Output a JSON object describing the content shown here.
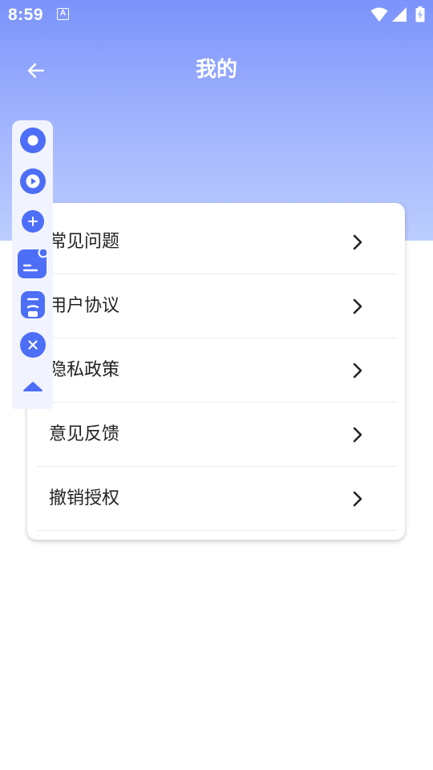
{
  "status_bar": {
    "time": "8:59",
    "notification_icon": "a-icon",
    "wifi_icon": "wifi-icon",
    "signal_icon": "signal-icon",
    "battery_icon": "battery-charging-icon"
  },
  "header": {
    "title": "我的",
    "back_icon": "arrow-left-icon"
  },
  "menu": {
    "items": [
      {
        "label": "常见问题",
        "icon": "chevron-right-icon"
      },
      {
        "label": "用户协议",
        "icon": "chevron-right-icon"
      },
      {
        "label": "隐私政策",
        "icon": "chevron-right-icon"
      },
      {
        "label": "意见反馈",
        "icon": "chevron-right-icon"
      },
      {
        "label": "撤销授权",
        "icon": "chevron-right-icon"
      }
    ]
  },
  "floating_toolbar": {
    "buttons": [
      "record-icon",
      "play-icon",
      "plus-icon",
      "document-icon",
      "person-icon",
      "close-icon",
      "collapse-up-icon"
    ]
  },
  "colors": {
    "header_gradient_top": "#7b93fb",
    "header_gradient_bottom": "#bccdfe",
    "accent": "#4d6ef6",
    "text": "#222222",
    "divider": "#ececec"
  }
}
